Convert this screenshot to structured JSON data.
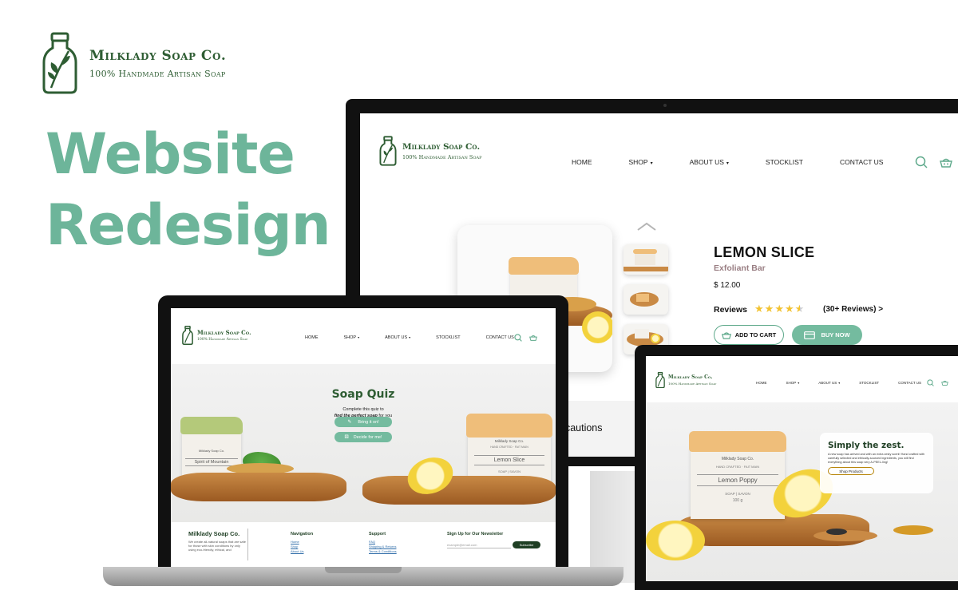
{
  "brand": {
    "name": "Milklady Soap Co.",
    "tagline": "100% Handmade Artisan Soap"
  },
  "hero": {
    "line1": "Website",
    "line2": "Redesign"
  },
  "nav": {
    "home": "HOME",
    "shop": "SHOP",
    "about": "ABOUT US",
    "stocklist": "STOCKLIST",
    "contact": "CONTACT US"
  },
  "desktop": {
    "product_name": "LEMON SLICE",
    "product_type": "Exfoliant Bar",
    "price": "$ 12.00",
    "reviews_label": "Reviews",
    "rating": 4.5,
    "reviews_count": "(30+ Reviews) >",
    "add_to_cart": "ADD TO CART",
    "buy_now": "BUY NOW",
    "section_partial": "ecautions"
  },
  "laptop": {
    "quiz_title": "Soap Quiz",
    "quiz_sub1": "Complete this quiz to",
    "quiz_sub2a": "find the perfect soap",
    "quiz_sub2b": " for you",
    "btn1": "Bring it on!",
    "btn2": "Decide for me!",
    "soap_left_label": "Spirit of Mountain",
    "soap_right_label": "Lemon Slice",
    "footer_brand": "Milklady Soap Co.",
    "footer_desc": "We create all-natural soaps that are safe for those with skin conditions by only using eco-friendly, ethical, and",
    "navigation_heading": "Navigation",
    "navigation_items": [
      "Home",
      "Shop",
      "About Us"
    ],
    "support_heading": "Support",
    "support_items": [
      "FAQ",
      "Shipping & Returns",
      "Terms & Conditions"
    ],
    "newsletter_heading": "Sign Up for Our Newsletter",
    "email_placeholder": "example@email.com",
    "subscribe": "Subscribe"
  },
  "tablet": {
    "zest_title": "Simply the zest.",
    "zest_body": "A new soap has arrived and with an extra zesty scent! Hand crafted with carefully selected and ethically-sourced ingredients, you will find everything about this soap very A-PEEL-ling!",
    "zest_btn": "Shop Products",
    "soap_label": "Lemon Poppy"
  },
  "soap_print": {
    "brand": "Milklady Soap Co.",
    "crafted": "HAND CRAFTED · FAIT MAIN",
    "kind": "SOAP | SAVON",
    "weight": "100 g"
  },
  "colors": {
    "brand_green": "#2e5d33",
    "accent": "#74bb9f",
    "hero_text": "#6db59a",
    "star": "#f2c230"
  }
}
